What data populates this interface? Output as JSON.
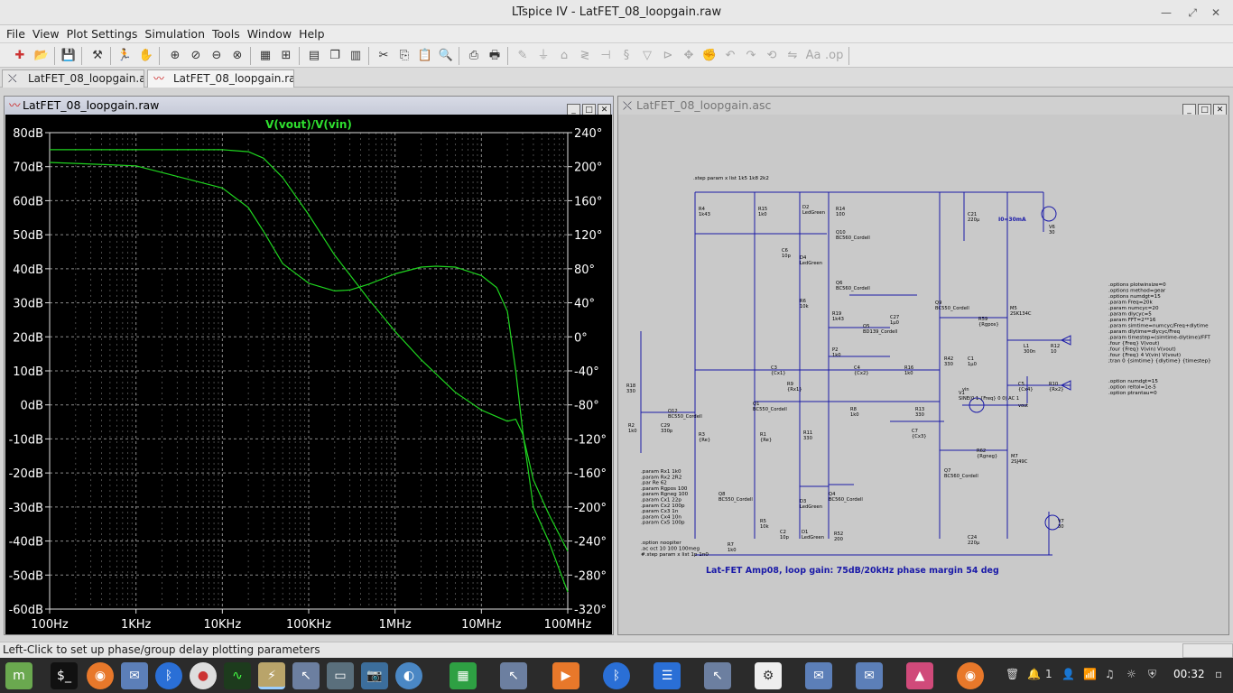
{
  "window": {
    "title": "LTspice IV - LatFET_08_loopgain.raw"
  },
  "menu": [
    "File",
    "View",
    "Plot Settings",
    "Simulation",
    "Tools",
    "Window",
    "Help"
  ],
  "tabs": [
    {
      "label": "LatFET_08_loopgain.asc",
      "active": false
    },
    {
      "label": "LatFET_08_loopgain.raw",
      "active": true
    }
  ],
  "plot_window": {
    "title": "LatFET_08_loopgain.raw",
    "trace_label": "V(vout)/V(vin)"
  },
  "schematic_window": {
    "title": "LatFET_08_loopgain.asc",
    "step_directive": ".step param x list 1k5 1k8 2k2",
    "options_block": [
      ".options plotwinsize=0",
      ".options method=gear",
      ".options numdgt=15",
      ".param Freq=20k",
      ".param numcyc=20",
      ".param dlycyc=5",
      ".param FFT=2**16",
      ".param simtime=numcyc/Freq+dlytime",
      ".param dlytime=dlycyc/Freq",
      ".param timestep=(simtime-dlytime)/FFT",
      ".four {Freq} V(vout)",
      ".four {Freq} V(vin) V(vout)",
      ".four {Freq} 4 V(vin) V(vout)",
      ";tran 0 {simtime} {dlytime} {timestep}"
    ],
    "options_block2": [
      ".option numdgt=15",
      ".option reltol=1e-5",
      ".option ptrantau=0"
    ],
    "params_block": [
      ".param Rx1 1k0",
      ".param Rx2 2R2",
      ".par Re 62",
      ".param Rgpos 100",
      ".param Rgneg 100",
      ".param Cx1 22p",
      ".param Cx2 100p",
      ".param Cx3 1n",
      ".param Cx4 10n",
      ".param Cx5 100p"
    ],
    "ac_block": [
      ".option noopiter",
      ".ac oct 10 100 100meg",
      "#.step param x list 1p 1n0"
    ],
    "caption": "Lat-FET Amp08, loop gain: 75dB/20kHz phase margin 54 deg",
    "io_label": "I0=30mA",
    "components": [
      {
        "ref": "R4",
        "val": "1k43"
      },
      {
        "ref": "R15",
        "val": "1k0"
      },
      {
        "ref": "D2",
        "val": "LedGreen"
      },
      {
        "ref": "R14",
        "val": "100"
      },
      {
        "ref": "Q10",
        "val": "BC560_Cordell"
      },
      {
        "ref": "C6",
        "val": "10p"
      },
      {
        "ref": "D4",
        "val": "LedGreen"
      },
      {
        "ref": "Q6",
        "val": "BC560_Cordell"
      },
      {
        "ref": "R6",
        "val": "10k"
      },
      {
        "ref": "R19",
        "val": "1k43"
      },
      {
        "ref": "Q5",
        "val": "BD139_Cordell"
      },
      {
        "ref": "C27",
        "val": "1µ0"
      },
      {
        "ref": "P2",
        "val": "1k0"
      },
      {
        "ref": "Q9",
        "val": "BC550_Cordell"
      },
      {
        "ref": "R59",
        "val": "{Rgpos}"
      },
      {
        "ref": "M5",
        "val": "2SK134C"
      },
      {
        "ref": "C21",
        "val": "220µ"
      },
      {
        "ref": "V6",
        "val": "30"
      },
      {
        "ref": "L1",
        "val": "300n"
      },
      {
        "ref": "R12",
        "val": "10"
      },
      {
        "ref": "R42",
        "val": "330"
      },
      {
        "ref": "C1",
        "val": "1µ0"
      },
      {
        "ref": "C5",
        "val": "{Cx4}"
      },
      {
        "ref": "R10",
        "val": "{Rx2}"
      },
      {
        "ref": "C3",
        "val": "{Cx1}"
      },
      {
        "ref": "R9",
        "val": "{Rx1}"
      },
      {
        "ref": "C4",
        "val": "{Cx2}"
      },
      {
        "ref": "R16",
        "val": "1k0"
      },
      {
        "ref": "R18",
        "val": "330"
      },
      {
        "ref": "Q12",
        "val": "BC550_Cordell"
      },
      {
        "ref": "Q1",
        "val": "BC550_Cordell"
      },
      {
        "ref": "R8",
        "val": "1k0"
      },
      {
        "ref": "R13",
        "val": "330"
      },
      {
        "ref": "V1",
        "val": "SINE(0 1 {Freq} 0 0) AC 1"
      },
      {
        "ref": "R2",
        "val": "1k0"
      },
      {
        "ref": "C29",
        "val": "330p"
      },
      {
        "ref": "R3",
        "val": "{Re}"
      },
      {
        "ref": "R1",
        "val": "{Re}"
      },
      {
        "ref": "R11",
        "val": "330"
      },
      {
        "ref": "C7",
        "val": "{Cx3}"
      },
      {
        "ref": "R62",
        "val": "{Rgneg}"
      },
      {
        "ref": "M7",
        "val": "2SJ49C"
      },
      {
        "ref": "Q7",
        "val": "BC560_Cordell"
      },
      {
        "ref": "Q8",
        "val": "BC550_Cordell"
      },
      {
        "ref": "Q4",
        "val": "BC560_Cordell"
      },
      {
        "ref": "R5",
        "val": "10k"
      },
      {
        "ref": "D3",
        "val": "LedGreen"
      },
      {
        "ref": "D1",
        "val": "LedGreen"
      },
      {
        "ref": "R7",
        "val": "1k0"
      },
      {
        "ref": "C2",
        "val": "10p"
      },
      {
        "ref": "R52",
        "val": "200"
      },
      {
        "ref": "C24",
        "val": "220µ"
      },
      {
        "ref": "V7",
        "val": "30"
      }
    ],
    "net_labels": [
      "vout",
      "vin"
    ]
  },
  "statusbar": {
    "text": "Left-Click to set up phase/group delay plotting parameters"
  },
  "taskbar": {
    "clock": "00:32",
    "workspace": "1"
  },
  "chart_data": {
    "type": "line",
    "title": "V(vout)/V(vin)",
    "x_scale": "log",
    "xlim": [
      100,
      100000000
    ],
    "x_ticks": [
      "100Hz",
      "1KHz",
      "10KHz",
      "100KHz",
      "1MHz",
      "10MHz",
      "100MHz"
    ],
    "y_left": {
      "ylim": [
        -60,
        80
      ],
      "ticks": [
        "80dB",
        "70dB",
        "60dB",
        "50dB",
        "40dB",
        "30dB",
        "20dB",
        "10dB",
        "0dB",
        "-10dB",
        "-20dB",
        "-30dB",
        "-40dB",
        "-50dB",
        "-60dB"
      ]
    },
    "y_right": {
      "ylim": [
        -320,
        240
      ],
      "ticks": [
        "240°",
        "200°",
        "160°",
        "120°",
        "80°",
        "40°",
        "0°",
        "-40°",
        "-80°",
        "-120°",
        "-160°",
        "-200°",
        "-240°",
        "-280°",
        "-320°"
      ]
    },
    "grid": true,
    "colors": {
      "background": "#000000",
      "trace": "#1fd41f",
      "grid": "#8a8a8a",
      "text": "#ffffff",
      "title": "#2fe02f"
    },
    "series": [
      {
        "axis": "left",
        "x": [
          100,
          1000,
          10000,
          20000,
          30000,
          50000,
          100000,
          200000,
          500000,
          1000000,
          2000000,
          5000000,
          10000000,
          20000000,
          25000000,
          30000000,
          40000000,
          60000000,
          100000000
        ],
        "y": [
          75,
          75,
          75,
          74.4,
          72.5,
          66.8,
          55.9,
          44,
          30.9,
          21.6,
          13.3,
          3.7,
          -1.5,
          -4.8,
          -4.2,
          -8.5,
          -22,
          -32,
          -43
        ]
      },
      {
        "axis": "right",
        "x": [
          100,
          1000,
          10000,
          20000,
          30000,
          50000,
          100000,
          200000,
          300000,
          500000,
          1000000,
          2000000,
          3000000,
          5000000,
          10000000,
          15000000,
          20000000,
          25000000,
          30000000,
          40000000,
          60000000,
          100000000
        ],
        "y": [
          205,
          201,
          175,
          152,
          124,
          86,
          63,
          54,
          55,
          62,
          74,
          82,
          83,
          82,
          72,
          58,
          30,
          -40,
          -110,
          -200,
          -240,
          -300
        ]
      }
    ]
  }
}
